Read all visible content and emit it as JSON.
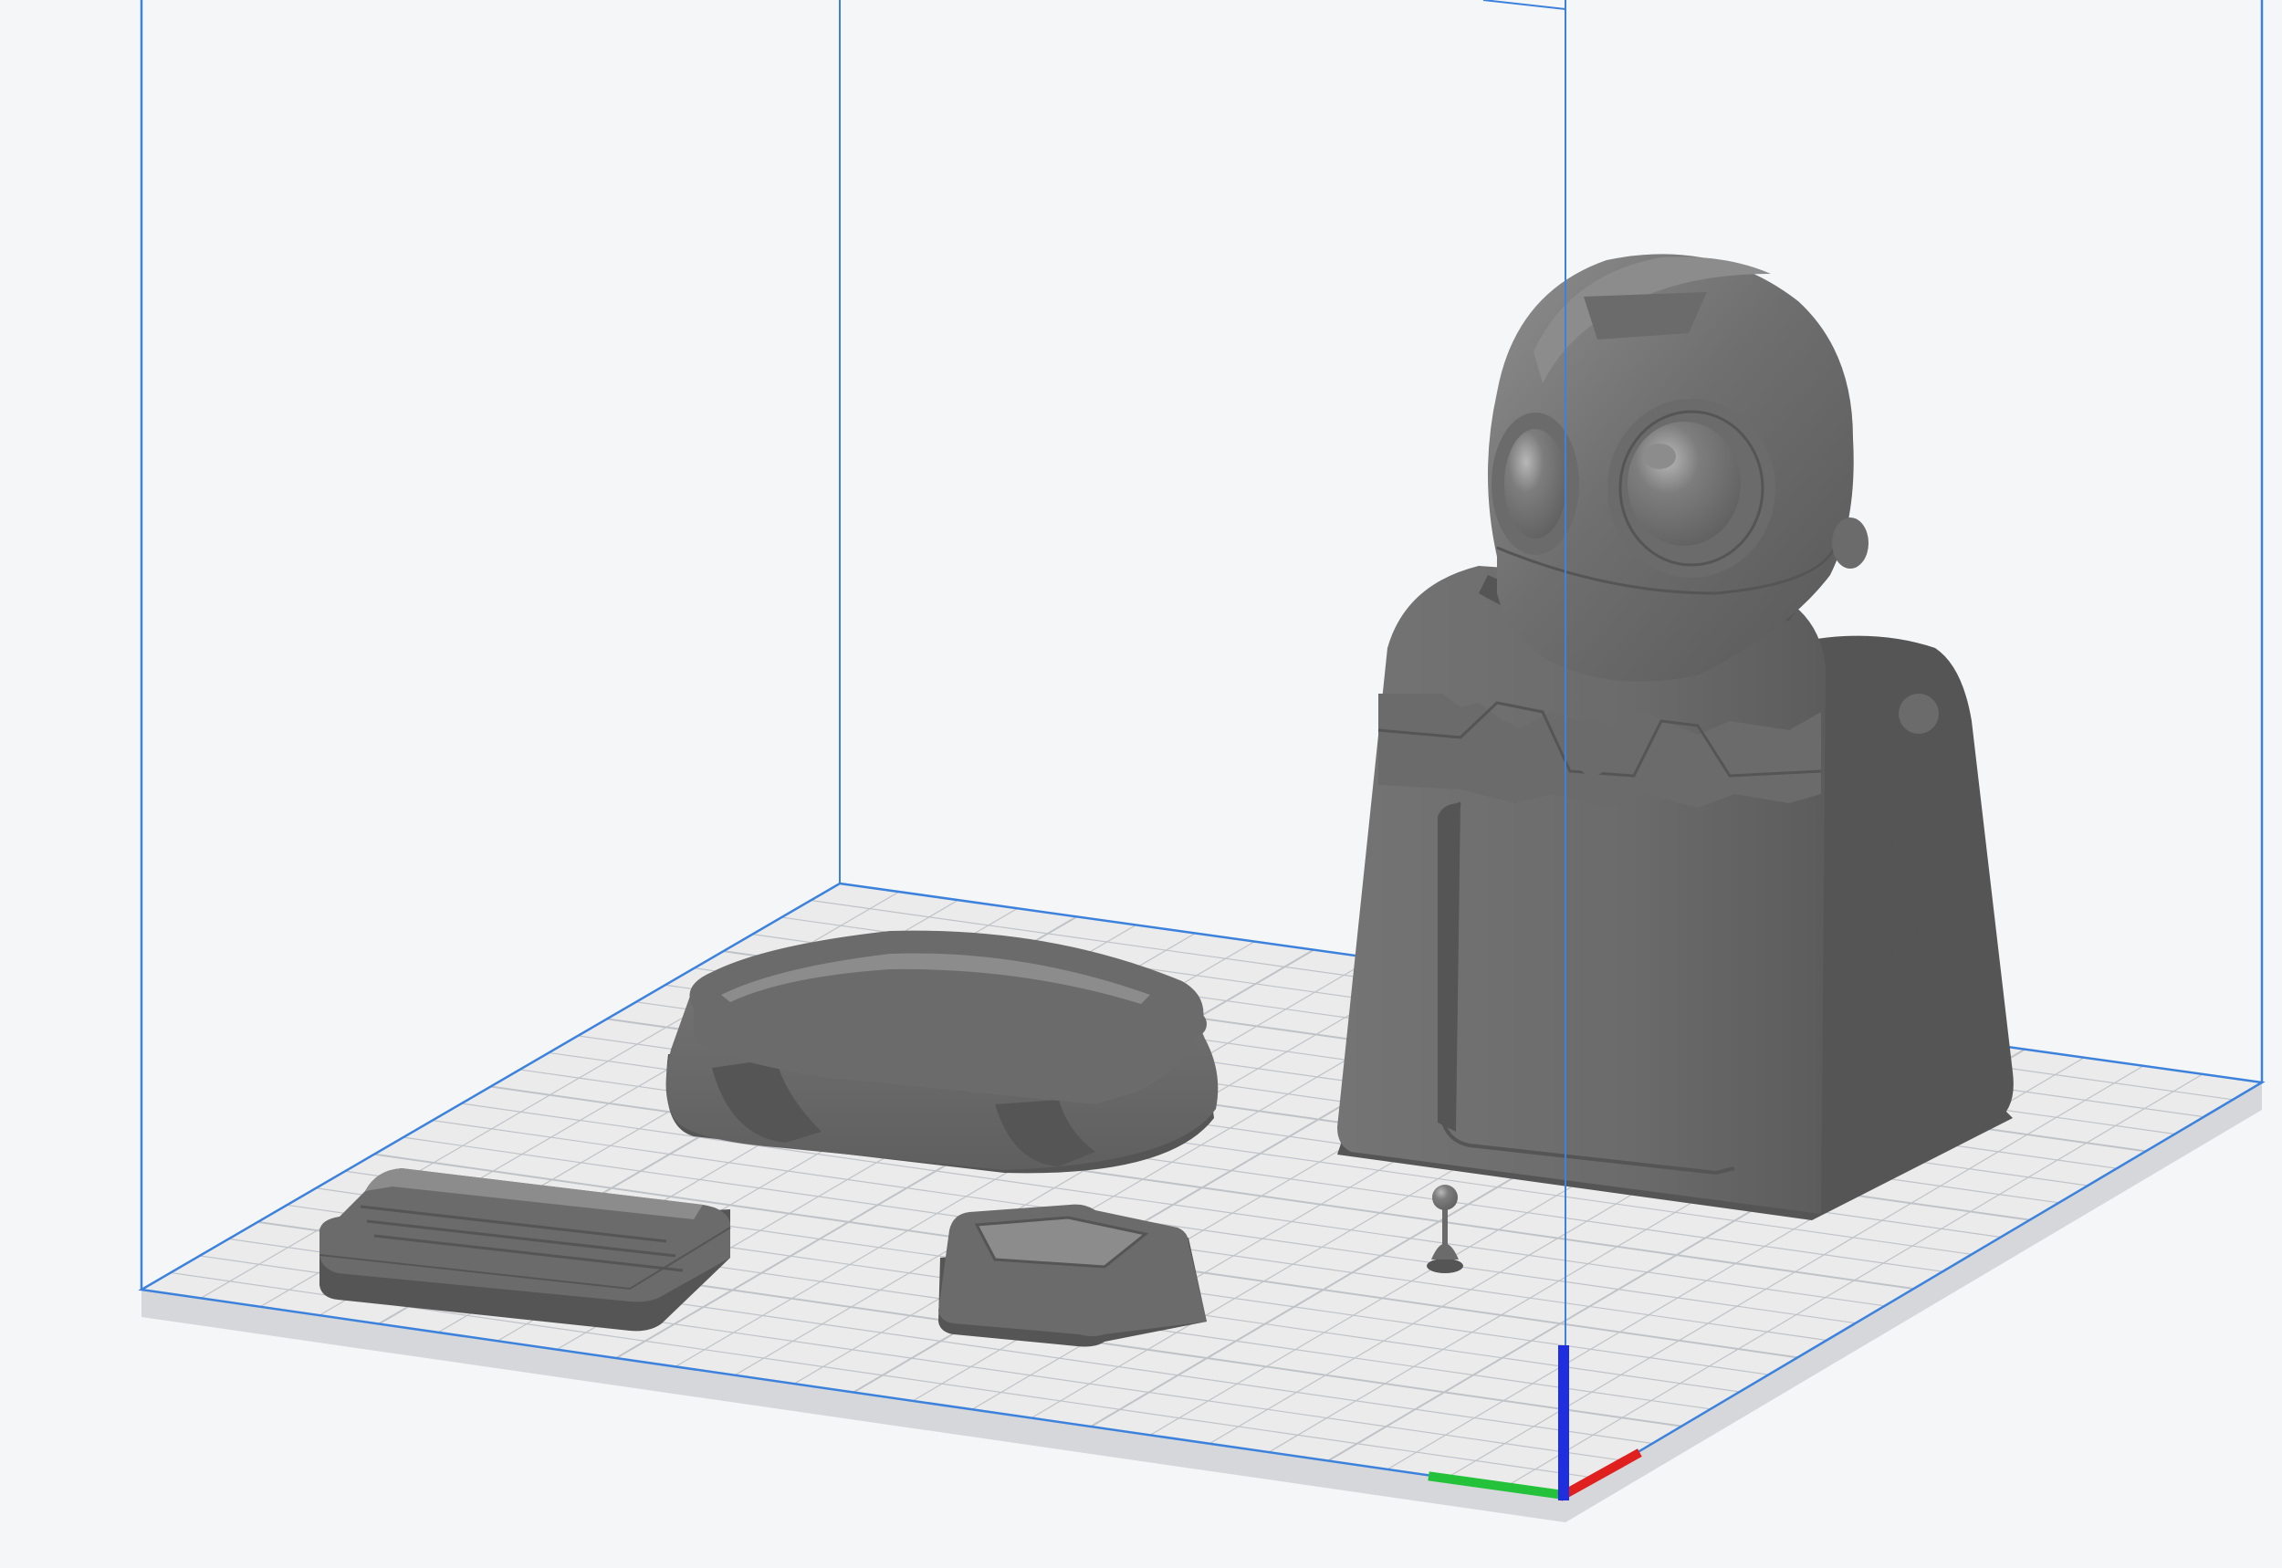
{
  "viewport": {
    "background_color": "#f5f6f8",
    "build_volume_edge_color": "#3c82dc",
    "plate_surface_color": "#ebebeb",
    "plate_gridline_color": "#bfc3c8",
    "plate_rim_color": "#d5d7da",
    "model_color": "#6b6b6b",
    "model_highlight_color": "#8c8c8c",
    "model_shadow_color": "#555555"
  },
  "axis_indicator": {
    "x_axis_color": "#e01f1f",
    "y_axis_color": "#23c23a",
    "z_axis_color": "#1f2fe0"
  },
  "models": [
    {
      "icon": "robot-body-model"
    },
    {
      "icon": "round-base-model"
    },
    {
      "icon": "rectangular-lid-model"
    },
    {
      "icon": "hexagonal-cap-model"
    },
    {
      "icon": "antenna-pin-model"
    }
  ]
}
